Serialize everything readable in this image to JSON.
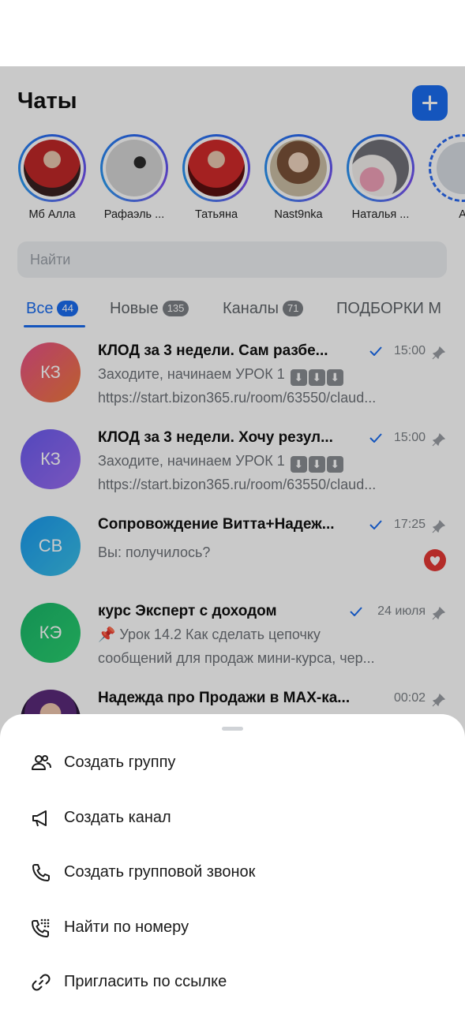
{
  "header": {
    "title": "Чаты"
  },
  "stories": [
    {
      "name": "Мб Алла",
      "bg": "#7a2a30"
    },
    {
      "name": "Рафаэль ...",
      "bg": "#c8c8c8"
    },
    {
      "name": "Татьяна",
      "bg": "#8a1a1a"
    },
    {
      "name": "Nast9nka",
      "bg": "#c7b49a"
    },
    {
      "name": "Наталья ...",
      "bg": "#6e6e7a"
    },
    {
      "name": "А",
      "bg": "#d8dde4"
    }
  ],
  "search": {
    "placeholder": "Найти"
  },
  "tabs": [
    {
      "label": "Все",
      "badge": "44"
    },
    {
      "label": "Новые",
      "badge": "135"
    },
    {
      "label": "Каналы",
      "badge": "71"
    },
    {
      "label": "ПОДБОРКИ М",
      "badge": ""
    }
  ],
  "chats": [
    {
      "initials": "КЗ",
      "title": "КЛОД за 3 недели. Сам разбе...",
      "time": "15:00",
      "line1": "Заходите, начинаем УРОК 1",
      "line1_emoji": [
        "⬇",
        "⬇",
        "⬇"
      ],
      "line2": "https://start.bizon365.ru/room/63550/claud...",
      "color1": "#e8508a",
      "color2": "#f07a3a"
    },
    {
      "initials": "КЗ",
      "title": "КЛОД за 3 недели. Хочу резул...",
      "time": "15:00",
      "line1": "Заходите, начинаем УРОК 1",
      "line1_emoji": [
        "⬇",
        "⬇",
        "⬇"
      ],
      "line2": "https://start.bizon365.ru/room/63550/claud...",
      "color1": "#6a5cf0",
      "color2": "#9a6cf0"
    },
    {
      "initials": "СВ",
      "title": "Сопровождение Витта+Надеж...",
      "time": "17:25",
      "line1": "Вы: получилось?",
      "line2": "",
      "color1": "#1a9af0",
      "color2": "#3ac0e8"
    },
    {
      "initials": "КЭ",
      "title": "курс Эксперт с доходом",
      "time": "24 июля",
      "line1": "📌 Урок 14.2 Как сделать цепочку",
      "line2": "сообщений для продаж мини-курса, чер...",
      "color1": "#1ab86a",
      "color2": "#2ad070"
    },
    {
      "initials": "",
      "title": "Надежда про Продажи в MAX-ка...",
      "time": "00:02",
      "line1": "",
      "line2": "",
      "color1": "#7a2a9a",
      "color2": "#d050a0"
    }
  ],
  "sheet": {
    "items": [
      {
        "label": "Создать группу",
        "icon": "group-icon"
      },
      {
        "label": "Создать канал",
        "icon": "megaphone-icon"
      },
      {
        "label": "Создать групповой звонок",
        "icon": "phone-icon"
      },
      {
        "label": "Найти по номеру",
        "icon": "dialpad-phone-icon"
      },
      {
        "label": "Пригласить по ссылке",
        "icon": "link-icon"
      }
    ]
  }
}
